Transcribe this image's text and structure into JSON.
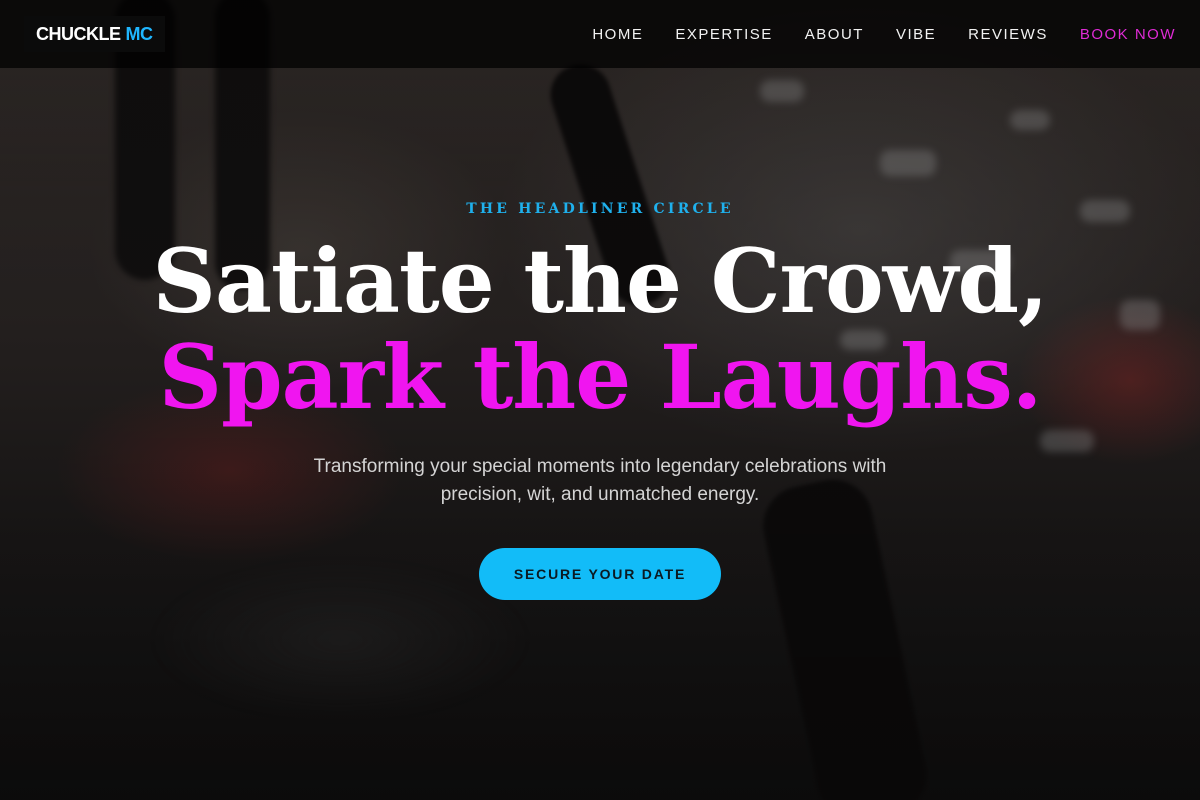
{
  "brand": {
    "name_part1": "CHUCKLE",
    "name_part2": "MC"
  },
  "nav": {
    "items": [
      {
        "label": "HOME"
      },
      {
        "label": "EXPERTISE"
      },
      {
        "label": "ABOUT"
      },
      {
        "label": "VIBE"
      },
      {
        "label": "REVIEWS"
      }
    ],
    "cta_label": "BOOK NOW"
  },
  "hero": {
    "eyebrow": "THE HEADLINER CIRCLE",
    "headline_line1": "Satiate the Crowd,",
    "headline_line2": "Spark the Laughs.",
    "subtitle": "Transforming your special moments into legendary celebrations with precision, wit, and unmatched energy.",
    "cta_label": "SECURE YOUR DATE"
  },
  "colors": {
    "accent_blue": "#1fb6ff",
    "accent_magenta": "#f015f0",
    "cta_background": "#12bcf8"
  }
}
